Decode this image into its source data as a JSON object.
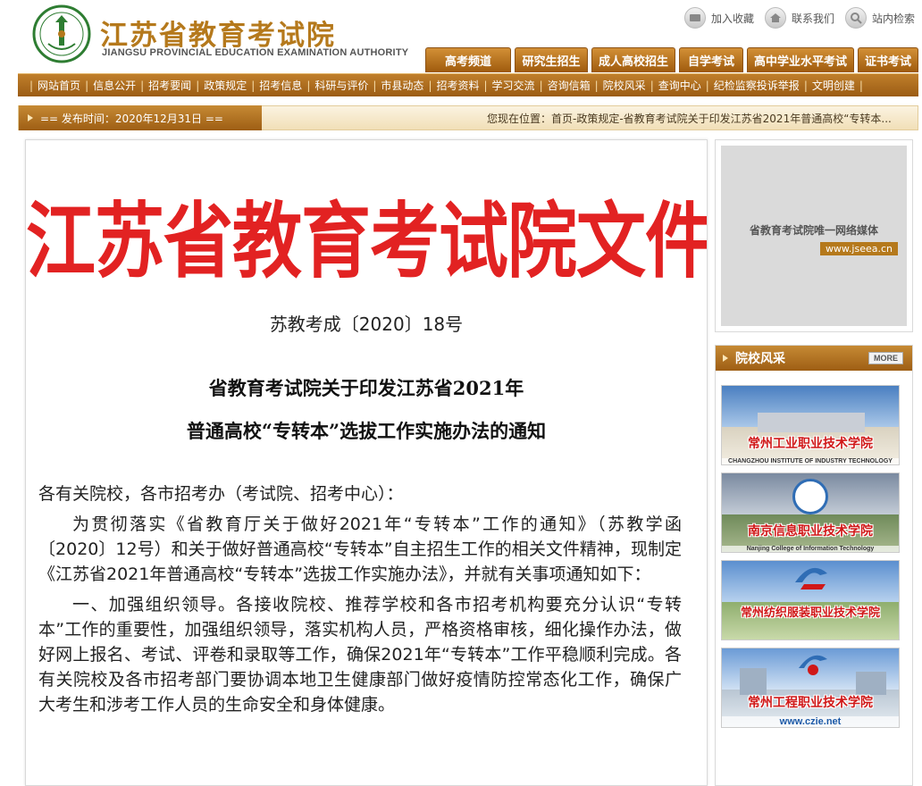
{
  "header": {
    "site_title": "江苏省教育考试院",
    "site_subtitle": "JIANGSU PROVINCIAL EDUCATION EXAMINATION AUTHORITY",
    "top_links": [
      "加入收藏",
      "联系我们",
      "站内检索"
    ],
    "channel_tabs": [
      "高考频道",
      "研究生招生",
      "成人高校招生",
      "自学考试",
      "高中学业水平考试",
      "证书考试"
    ]
  },
  "nav": {
    "items": [
      "网站首页",
      "信息公开",
      "招考要闻",
      "政策规定",
      "招考信息",
      "科研与评价",
      "市县动态",
      "招考资料",
      "学习交流",
      "咨询信箱",
      "院校风采",
      "查询中心",
      "纪检监察投诉举报",
      "文明创建"
    ]
  },
  "info_bar": {
    "date_text": "== 发布时间：2020年12月31日 ==",
    "breadcrumb": "您现在位置：首页-政策规定-省教育考试院关于印发江苏省2021年普通高校“专转本..."
  },
  "article": {
    "header_title": "江苏省教育考试院文件",
    "doc_number": "苏教考成〔2020〕18号",
    "title_line1": "省教育考试院关于印发江苏省2021年",
    "title_line2": "普通高校“专转本”选拔工作实施办法的通知",
    "salutation": "各有关院校，各市招考办（考试院、招考中心）：",
    "para1": "为贯彻落实《省教育厅关于做好2021年“专转本”工作的通知》（苏教学函〔2020〕12号）和关于做好普通高校“专转本”自主招生工作的相关文件精神，现制定《江苏省2021年普通高校“专转本”选拔工作实施办法》，并就有关事项通知如下：",
    "para2": "一、加强组织领导。各接收院校、推荐学校和各市招考机构要充分认识“专转本”工作的重要性，加强组织领导，落实机构人员，严格资格审核，细化操作办法，做好网上报名、考试、评卷和录取等工作，确保2021年“专转本”工作平稳顺利完成。各有关院校及各市招考部门要协调本地卫生健康部门做好疫情防控常态化工作，确保广大考生和涉考工作人员的生命安全和身体健康。"
  },
  "sidebar": {
    "media_caption": "省教育考试院唯一网络媒体",
    "media_url": "www.jseea.cn",
    "campus_heading": "院校风采",
    "more_label": "MORE",
    "campus": [
      {
        "name": "常州工业职业技术学院",
        "en": "CHANGZHOU INSTITUTE OF INDUSTRY TECHNOLOGY"
      },
      {
        "name": "南京信息职业技术学院",
        "en": "Nanjing College of Information Technology"
      },
      {
        "name": "常州纺织服装职业技术学院",
        "en": ""
      },
      {
        "name": "常州工程职业技术学院",
        "url": "www.czie.net"
      }
    ]
  },
  "colors": {
    "brand_gold": "#b5791c",
    "nav_brown": "#9b5c14",
    "doc_red": "#e22222"
  }
}
